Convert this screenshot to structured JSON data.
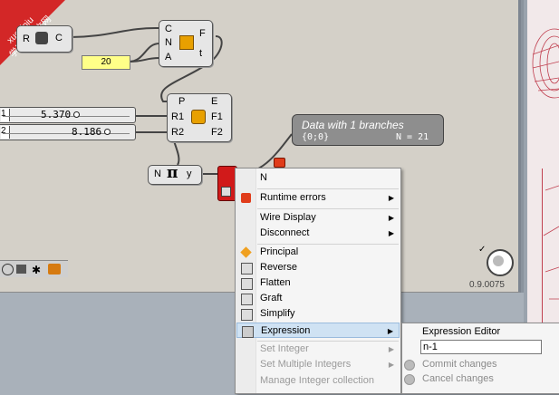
{
  "banner": {
    "site": "xuexiniu",
    "label": "学犀牛中文网"
  },
  "nodes": {
    "top_left": {
      "output": "C",
      "input": "R"
    },
    "number_panel": {
      "value": "20"
    },
    "arc_node": {
      "inputs": [
        "C",
        "N",
        "A"
      ],
      "outputs": [
        "F",
        "t"
      ]
    },
    "pt_node": {
      "inputs": [
        "P",
        "R1",
        "R2"
      ],
      "outputs": [
        "E",
        "F1",
        "F2"
      ]
    },
    "expr_node": {
      "input": "N",
      "symbol": "π",
      "output": "y"
    },
    "data_panel": {
      "title": "Data with 1 branches",
      "path": "{0;0}",
      "count": "N = 21"
    }
  },
  "sliders": [
    {
      "index": "1",
      "value": "5.370"
    },
    {
      "index": "2",
      "value": "8.186"
    }
  ],
  "status": {
    "zoom": "0.9.0075"
  },
  "context_menu": {
    "header": "N",
    "items": [
      {
        "label": "Runtime errors",
        "submenu": true,
        "icon": "error-balloon-icon",
        "disabled": false
      },
      {
        "label": "Wire Display",
        "submenu": true,
        "icon": "",
        "disabled": false
      },
      {
        "label": "Disconnect",
        "submenu": true,
        "icon": "",
        "disabled": false
      },
      {
        "label": "Principal",
        "submenu": false,
        "icon": "principal-icon",
        "disabled": false
      },
      {
        "label": "Reverse",
        "submenu": false,
        "icon": "reverse-icon",
        "disabled": false
      },
      {
        "label": "Flatten",
        "submenu": false,
        "icon": "flatten-icon",
        "disabled": false
      },
      {
        "label": "Graft",
        "submenu": false,
        "icon": "graft-icon",
        "disabled": false
      },
      {
        "label": "Simplify",
        "submenu": false,
        "icon": "simplify-icon",
        "disabled": false
      },
      {
        "label": "Expression",
        "submenu": true,
        "icon": "expression-icon",
        "disabled": false,
        "highlighted": true
      },
      {
        "label": "Set Integer",
        "submenu": true,
        "icon": "",
        "disabled": true
      },
      {
        "label": "Set Multiple Integers",
        "submenu": true,
        "icon": "",
        "disabled": true
      },
      {
        "label": "Manage Integer collection",
        "submenu": false,
        "icon": "",
        "disabled": true
      }
    ]
  },
  "expression_submenu": {
    "title": "Expression Editor",
    "input_value": "n-1",
    "commit": "Commit changes",
    "cancel": "Cancel changes"
  }
}
